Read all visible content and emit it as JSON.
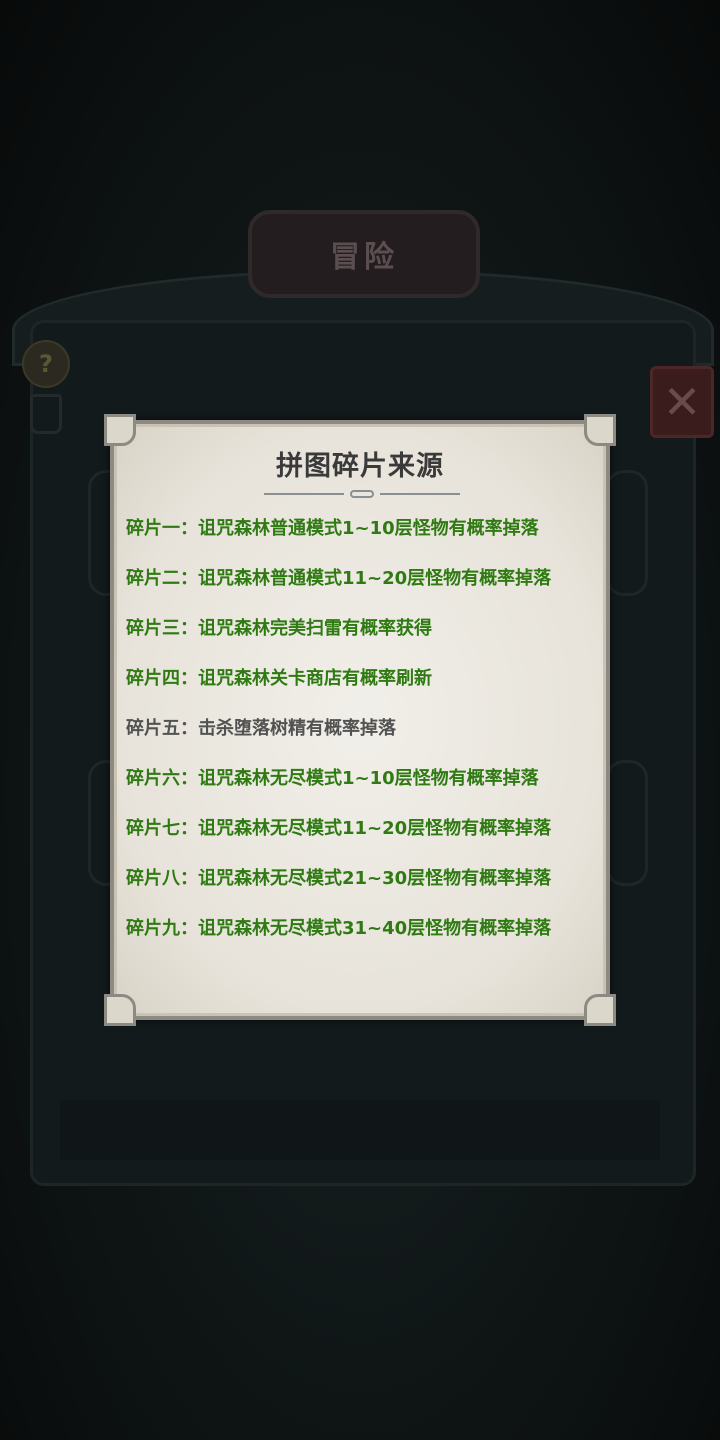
{
  "background": {
    "title": "冒险",
    "help_icon": "question-icon",
    "close_icon": "close-x-icon"
  },
  "dialog": {
    "title": "拼图碎片来源",
    "sources": [
      {
        "label": "碎片一：",
        "text": "诅咒森林普通模式1~10层怪物有概率掉落",
        "state": "green"
      },
      {
        "label": "碎片二：",
        "text": "诅咒森林普通模式11~20层怪物有概率掉落",
        "state": "green"
      },
      {
        "label": "碎片三：",
        "text": "诅咒森林完美扫雷有概率获得",
        "state": "green"
      },
      {
        "label": "碎片四：",
        "text": "诅咒森林关卡商店有概率刷新",
        "state": "green"
      },
      {
        "label": "碎片五：",
        "text": "击杀堕落树精有概率掉落",
        "state": "gray"
      },
      {
        "label": "碎片六：",
        "text": "诅咒森林无尽模式1~10层怪物有概率掉落",
        "state": "green"
      },
      {
        "label": "碎片七：",
        "text": "诅咒森林无尽模式11~20层怪物有概率掉落",
        "state": "green"
      },
      {
        "label": "碎片八：",
        "text": "诅咒森林无尽模式21~30层怪物有概率掉落",
        "state": "green"
      },
      {
        "label": "碎片九：",
        "text": "诅咒森林无尽模式31~40层怪物有概率掉落",
        "state": "green"
      }
    ]
  },
  "colors": {
    "obtainable": "#2f7a12",
    "unavailable": "#525252"
  }
}
